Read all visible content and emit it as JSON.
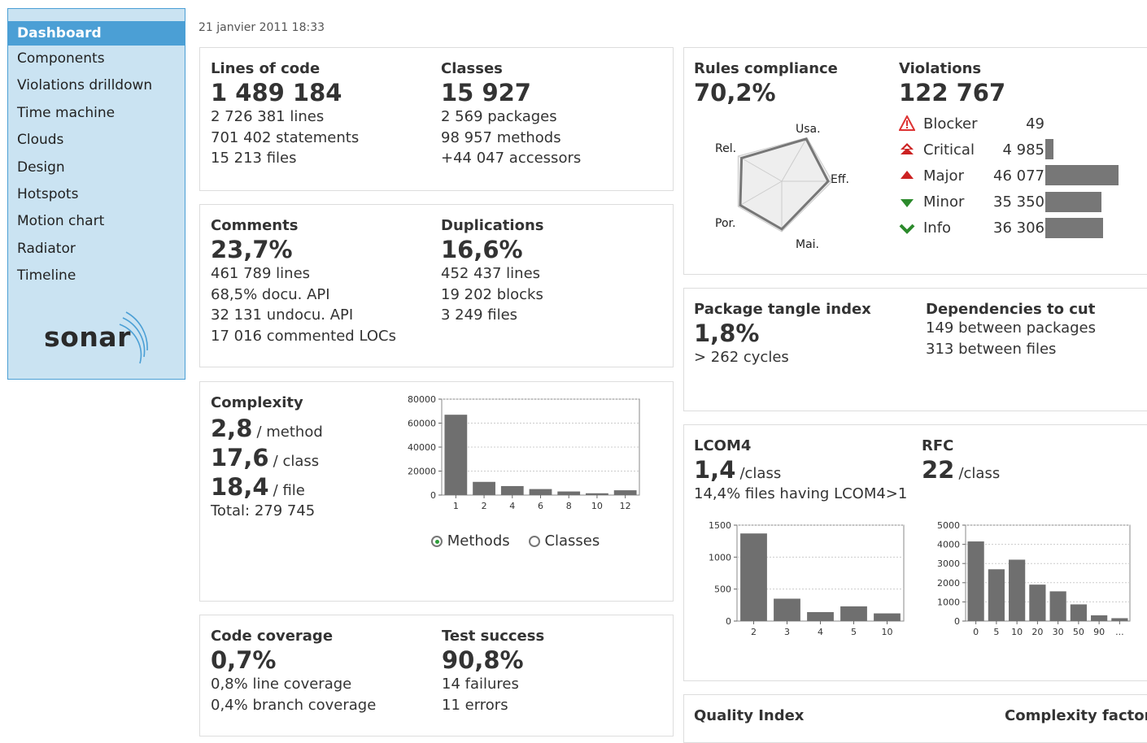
{
  "sidebar": {
    "items": [
      {
        "label": "Dashboard",
        "active": true
      },
      {
        "label": "Components"
      },
      {
        "label": "Violations drilldown"
      },
      {
        "label": "Time machine"
      },
      {
        "label": "Clouds"
      },
      {
        "label": "Design"
      },
      {
        "label": "Hotspots"
      },
      {
        "label": "Motion chart"
      },
      {
        "label": "Radiator"
      },
      {
        "label": "Timeline"
      }
    ],
    "logo": "sonar"
  },
  "date": "21 janvier 2011 18:33",
  "size": {
    "loc": {
      "title": "Lines of code",
      "value": "1 489 184",
      "lines": [
        "2 726 381 lines",
        "701 402 statements",
        "15 213 files"
      ]
    },
    "classes": {
      "title": "Classes",
      "value": "15 927",
      "lines": [
        "2 569 packages",
        "98 957 methods",
        "+44 047 accessors"
      ]
    }
  },
  "comments": {
    "comments": {
      "title": "Comments",
      "value": "23,7%",
      "lines": [
        "461 789 lines",
        "68,5% docu. API",
        "32 131 undocu. API",
        "17 016 commented LOCs"
      ]
    },
    "duplications": {
      "title": "Duplications",
      "value": "16,6%",
      "lines": [
        "452 437 lines",
        "19 202 blocks",
        "3 249 files"
      ]
    }
  },
  "complexity": {
    "title": "Complexity",
    "per_method": "2,8",
    "per_method_unit": "/ method",
    "per_class": "17,6",
    "per_class_unit": "/ class",
    "per_file": "18,4",
    "per_file_unit": "/ file",
    "total": "Total: 279 745",
    "radio_methods": "Methods",
    "radio_classes": "Classes"
  },
  "coverage": {
    "coverage": {
      "title": "Code coverage",
      "value": "0,7%",
      "lines": [
        "0,8% line coverage",
        "0,4% branch coverage"
      ]
    },
    "tests": {
      "title": "Test success",
      "value": "90,8%",
      "lines": [
        "14 failures",
        "11 errors"
      ]
    }
  },
  "rules": {
    "title": "Rules compliance",
    "value": "70,2%",
    "radar_labels": {
      "usa": "Usa.",
      "eff": "Eff.",
      "mai": "Mai.",
      "por": "Por.",
      "rel": "Rel."
    },
    "violations_title": "Violations",
    "violations_value": "122 767",
    "violations": [
      {
        "label": "Blocker",
        "count": "49",
        "icon": "blocker-icon",
        "value": 49
      },
      {
        "label": "Critical",
        "count": "4 985",
        "icon": "critical-icon",
        "value": 4985
      },
      {
        "label": "Major",
        "count": "46 077",
        "icon": "major-icon",
        "value": 46077
      },
      {
        "label": "Minor",
        "count": "35 350",
        "icon": "minor-icon",
        "value": 35350
      },
      {
        "label": "Info",
        "count": "36 306",
        "icon": "info-icon",
        "value": 36306
      }
    ]
  },
  "tangle": {
    "title": "Package tangle index",
    "value": "1,8%",
    "sub": "> 262 cycles",
    "deps_title": "Dependencies to cut",
    "deps_lines": [
      "149 between packages",
      "313 between files"
    ]
  },
  "lcom": {
    "title": "LCOM4",
    "value": "1,4",
    "unit": "/class",
    "sub": "14,4% files having LCOM4>1",
    "rfc_title": "RFC",
    "rfc_value": "22",
    "rfc_unit": "/class"
  },
  "quality": {
    "title": "Quality Index",
    "factor": "Complexity factor"
  },
  "chart_data": [
    {
      "type": "bar",
      "name": "complexity-distribution",
      "categories": [
        "1",
        "2",
        "4",
        "6",
        "8",
        "10",
        "12"
      ],
      "values": [
        67000,
        11000,
        7500,
        5000,
        3000,
        1500,
        4000
      ],
      "ylim": [
        0,
        80000
      ],
      "yticks": [
        "0",
        "20000",
        "40000",
        "60000",
        "80000"
      ]
    },
    {
      "type": "bar",
      "name": "lcom4-distribution",
      "categories": [
        "2",
        "3",
        "4",
        "5",
        "10"
      ],
      "values": [
        1370,
        350,
        140,
        230,
        120
      ],
      "ylim": [
        0,
        1500
      ],
      "yticks": [
        "0",
        "500",
        "1000",
        "1500"
      ]
    },
    {
      "type": "bar",
      "name": "rfc-distribution",
      "categories": [
        "0",
        "5",
        "10",
        "20",
        "30",
        "50",
        "90",
        "..."
      ],
      "values": [
        4150,
        2700,
        3200,
        1900,
        1550,
        870,
        300,
        150
      ],
      "ylim": [
        0,
        5000
      ],
      "yticks": [
        "0",
        "1000",
        "2000",
        "3000",
        "4000",
        "5000"
      ]
    },
    {
      "type": "radar",
      "name": "rules-compliance-radar",
      "axes": [
        "Usa.",
        "Eff.",
        "Mai.",
        "Por.",
        "Rel."
      ],
      "values": [
        0.97,
        0.92,
        0.95,
        0.95,
        0.92
      ]
    }
  ]
}
